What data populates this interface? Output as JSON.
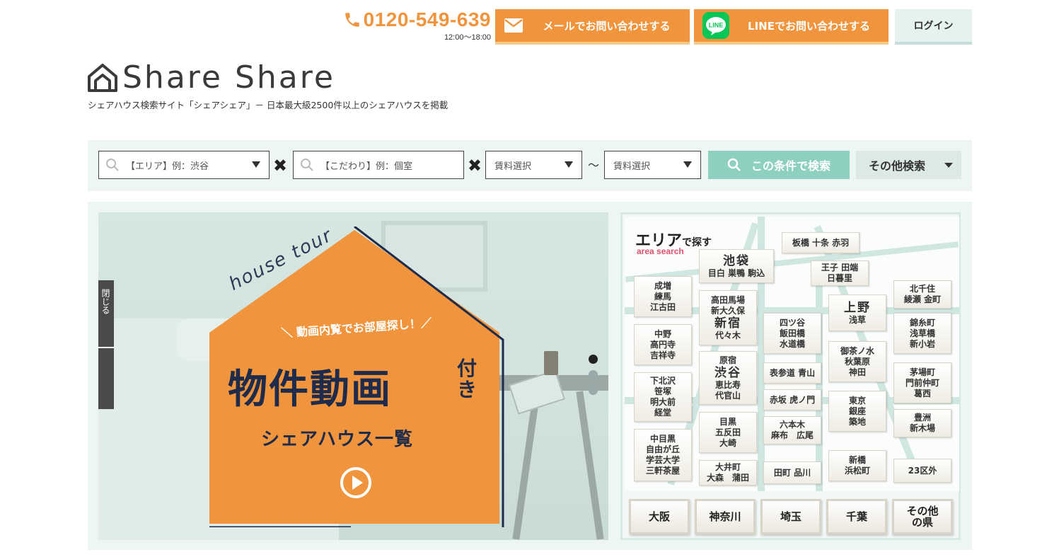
{
  "header": {
    "phone": "0120-549-639",
    "hours": "12:00〜18:00",
    "mail_button": "メールでお問い合わせする",
    "line_button": "LINEでお問い合わせする",
    "line_icon_text": "LINE",
    "login_button": "ログイン"
  },
  "logo": {
    "text": "Share Share",
    "tagline": "シェアハウス検索サイト「シェアシェア」－ 日本最大級2500件以上のシェアハウスを掲載"
  },
  "search": {
    "area_placeholder": "【エリア】例：渋谷",
    "kodawari_placeholder": "【こだわり】例：個室",
    "rent_min": "賃料選択",
    "rent_max": "賃料選択",
    "times": "✖",
    "tilde": "〜",
    "search_button": "この条件で検索",
    "other_button": "その他検索"
  },
  "slider": {
    "house_tour": "house tour",
    "tagline": "＼ 動画内覧でお部屋探し！／",
    "title_main": "物件動画",
    "title_small": "付き",
    "subtitle": "シェアハウス一覧",
    "side_tab_text": "閉じる",
    "active_slide": 1,
    "slide_count": 3
  },
  "area_map": {
    "title": "エリア",
    "title_suffix": "で探す",
    "subtitle": "area search",
    "areas": {
      "itabashi": "板橋 十条 赤羽",
      "ikebukuro_main": "池袋",
      "ikebukuro_sub": "目白 巣鴨 駒込",
      "oji": "王子 田端",
      "oji2": "日暮里",
      "narimasu": [
        "成増",
        "練馬",
        "江古田"
      ],
      "kitasenju": [
        "北千住",
        "綾瀬 金町"
      ],
      "takadanobaba": [
        "高田馬場",
        "新大久保"
      ],
      "shinjuku": "新宿",
      "yoyogi": "代々木",
      "yotsuya": [
        "四ツ谷",
        "飯田橋",
        "水道橋"
      ],
      "ueno": "上野",
      "asakusa": "浅草",
      "nakano": [
        "中野",
        "高円寺",
        "吉祥寺"
      ],
      "kinshicho": [
        "錦糸町",
        "浅草橋",
        "新小岩"
      ],
      "ochanomizu": [
        "御茶ノ水",
        "秋葉原",
        "神田"
      ],
      "harajuku": "原宿",
      "shibuya": "渋谷",
      "ebisu": [
        "恵比寿",
        "代官山"
      ],
      "omotesando": "表参道 青山",
      "shimokitazawa": [
        "下北沢",
        "笹塚",
        "明大前",
        "経堂"
      ],
      "kayabacho": [
        "茅場町",
        "門前仲町",
        "葛西"
      ],
      "akasaka": "赤坂 虎ノ門",
      "tokyo": [
        "東京",
        "銀座",
        "築地"
      ],
      "roppongi": [
        "六本木",
        "麻布　広尾"
      ],
      "meguro": [
        "目黒",
        "五反田",
        "大崎"
      ],
      "toyosu": [
        "豊洲",
        "新木場"
      ],
      "nakameguro": [
        "中目黒",
        "自由が丘",
        "学芸大学",
        "三軒茶屋"
      ],
      "oimachi": [
        "大井町",
        "大森　蒲田"
      ],
      "tamachi": "田町 品川",
      "shinbashi": [
        "新橋",
        "浜松町"
      ],
      "outside": "23区外"
    },
    "prefectures": [
      "大阪",
      "神奈川",
      "埼玉",
      "千葉",
      "その他の県"
    ]
  },
  "colors": {
    "orange": "#f0953d",
    "mint": "#8ed0bf",
    "navy": "#1f2b4a",
    "pale": "#eef6f4",
    "line_green": "#06c755"
  }
}
